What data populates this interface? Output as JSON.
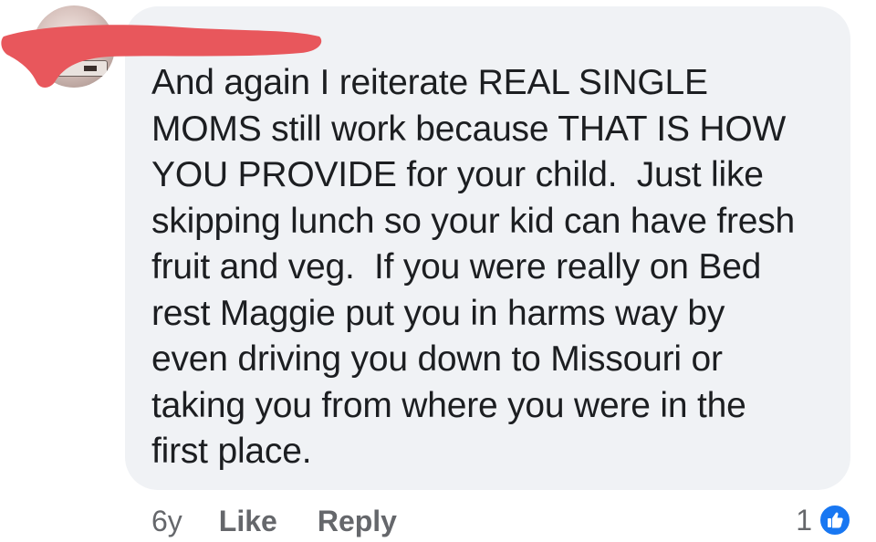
{
  "comment": {
    "author_avatar_icon": "profile-avatar",
    "text": "And again I reiterate REAL SINGLE\nMOMS still work because THAT IS HOW\nYOU PROVIDE for your child.  Just like\nskipping lunch so your kid can have fresh\nfruit and veg.  If you were really on Bed\nrest Maggie put you in harms way by\neven driving you down to Missouri or\ntaking you from where you were in the\nfirst place.",
    "timestamp": "6y",
    "like_label": "Like",
    "reply_label": "Reply",
    "reaction_count": "1",
    "reaction_icon": "thumbs-up-icon"
  },
  "colors": {
    "bubble": "#f0f2f5",
    "text": "#1c1e21",
    "secondary_text": "#65676b",
    "like_blue": "#1877f2",
    "redaction": "#e8575c"
  }
}
